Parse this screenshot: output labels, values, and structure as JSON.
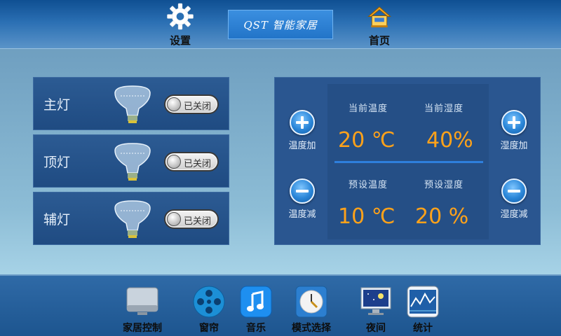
{
  "header": {
    "settings_label": "设置",
    "brand": "QST 智能家居",
    "home_label": "首页"
  },
  "lights": [
    {
      "name": "主灯",
      "state_label": "已关闭"
    },
    {
      "name": "顶灯",
      "state_label": "已关闭"
    },
    {
      "name": "辅灯",
      "state_label": "已关闭"
    }
  ],
  "climate": {
    "temp_up_label": "温度加",
    "temp_down_label": "温度减",
    "humidity_up_label": "湿度加",
    "humidity_down_label": "湿度减",
    "current_temp_caption": "当前温度",
    "current_humidity_caption": "当前湿度",
    "preset_temp_caption": "预设温度",
    "preset_humidity_caption": "预设湿度",
    "current_temp": "20 ℃",
    "current_humidity": "40%",
    "preset_temp": "10 ℃",
    "preset_humidity": "20 %"
  },
  "dock": [
    {
      "label": "家居控制",
      "icon": "monitor-icon"
    },
    {
      "label": "窗帘",
      "icon": "film-reel-icon"
    },
    {
      "label": "音乐",
      "icon": "music-note-icon"
    },
    {
      "label": "模式选择",
      "icon": "clock-icon"
    },
    {
      "label": "夜间",
      "icon": "night-screen-icon"
    },
    {
      "label": "统计",
      "icon": "chart-icon"
    }
  ],
  "colors": {
    "header": "#1a5a9c",
    "reading": "#ffa21a",
    "panel": "#2a5690"
  }
}
